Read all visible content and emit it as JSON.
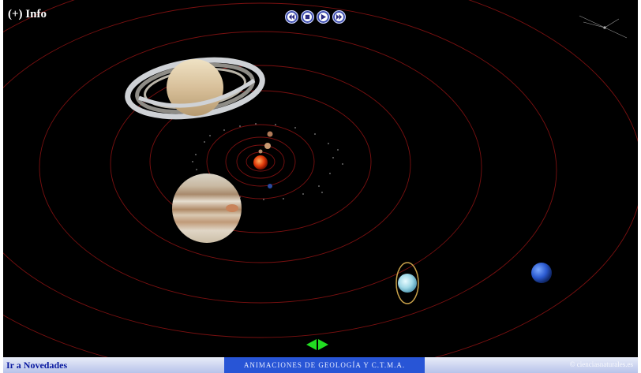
{
  "header": {
    "info_label": "(+) Info"
  },
  "controls": {
    "buttons": [
      "rewind",
      "stop",
      "play",
      "fast-forward"
    ]
  },
  "planets": [
    "sun",
    "mercury",
    "venus",
    "earth",
    "mars",
    "jupiter",
    "saturn",
    "uranus",
    "neptune"
  ],
  "footer": {
    "novedades_label": "Ir a Novedades",
    "banner_text": "ANIMACIONES DE GEOLOGÍA Y C.T.M.A.",
    "copyright": "© cienciasnaturales.es"
  },
  "colors": {
    "background": "#000000",
    "orbit": "#7a1010",
    "nav_arrow": "#22dd22",
    "banner": "#2855d6",
    "link": "#0a1aa0"
  }
}
